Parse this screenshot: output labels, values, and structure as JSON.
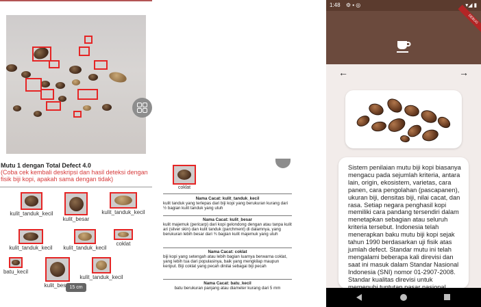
{
  "left": {
    "summary_title": "Mutu 1 dengan Total Defect 4.0",
    "summary_note": "(Coba cek kembali deskripsi dan hasil deteksi dengan fisik biji kopi, apakah sama dengan tidak)",
    "detections": [
      {
        "label": "kulit_tanduk_kecil"
      },
      {
        "label": "kulit_besar"
      },
      {
        "label": "kulit_tanduk_kecil"
      },
      {
        "label": "kulit_tanduk_kecil"
      },
      {
        "label": "kulit_tanduk_kecil"
      },
      {
        "label": "coklat"
      },
      {
        "label": "batu_kecil"
      },
      {
        "label": "kulit_besar"
      },
      {
        "label": "kulit_tanduk_kecil"
      }
    ],
    "toast": "15 cm"
  },
  "middle": {
    "thumb_label": "coklat",
    "entries": [
      {
        "name": "Nama Cacat: kulit_tanduk_kecil",
        "desc": "kulit tanduk yang terlepas dari biji kopi yang berukuran kurang dari ½ bagian kulit tanduk yang utuh"
      },
      {
        "name": "Nama Cacat: kulit_besar",
        "desc": "kulit majemuk (pericarp) dari kopi gelondong dengan atau tanpa kulit ari (silver skin) dan kulit tanduk (parchment) di dalamnya, yang berukuran lebih besar dari ¾ bagian kulit majemuk yang utuh"
      },
      {
        "name": "Nama Cacat: coklat",
        "desc": "biji kopi yang setengah atau lebih bagian luarnya berwarna coklat, yang lebih tua dari populasinya, baik yang mengkilap maupun keriput. Biji coklat yang pecah dinilai sebagai biji pecah"
      },
      {
        "name": "Nama Cacat: batu_kecil",
        "desc": "batu berukuran panjang atau diameter kurang dari 5 mm"
      }
    ]
  },
  "phone": {
    "status_time": "1:48",
    "debug_banner": "DEBUG",
    "back_arrow": "←",
    "forward_arrow": "→",
    "description": "Sistem penilaian mutu biji kopi biasanya mengacu pada sejumlah kriteria, antara lain, origin, ekosistem, varietas, cara panen, cara pengolahan (pascapanen), ukuran biji, densitas biji, nilai cacat, dan rasa. Setiap negara penghasil kopi memiliki cara pandang tersendiri dalam menetapkan sebagian atau seluruh kriteria tersebut. Indonesia telah menerapkan baku mutu biji kopi sejak tahun 1990 berdasarkan uji fisik atas jumlah defect. Standar mutu ini telah mengalami beberapa kali direvisi dan saat ini masuk dalam Standar Nasional Indonesia (SNI) nomor 01-2907-2008. Standar kualitas direvisi untuk memenuhi tuntutan pasar nasional",
    "appbar_color": "#6b4a3d"
  }
}
